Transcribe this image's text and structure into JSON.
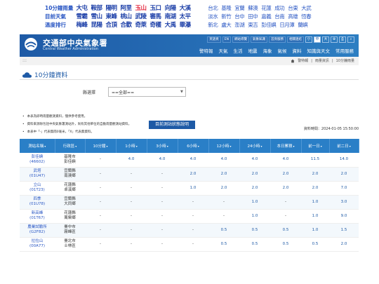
{
  "toplinks": [
    {
      "label": "10分鐘雨量",
      "group1": [
        {
          "t": "大屯",
          "red": false
        },
        {
          "t": "鞍部",
          "red": false
        },
        {
          "t": "陽明",
          "red": false
        },
        {
          "t": "阿里",
          "red": false
        },
        {
          "t": "玉山",
          "red": true
        },
        {
          "t": "玉口",
          "red": false
        },
        {
          "t": "向陽",
          "red": false
        },
        {
          "t": "大溪",
          "red": false
        }
      ],
      "group2": [
        "台北",
        "基隆",
        "宜蘭",
        "蘇澳",
        "花蓮",
        "成功",
        "台東",
        "大武"
      ]
    },
    {
      "label": "目前天氣",
      "group1": [
        {
          "t": "雪霸",
          "red": false
        },
        {
          "t": "雪山",
          "red": false
        },
        {
          "t": "東峰",
          "red": false
        },
        {
          "t": "桃山",
          "red": false
        },
        {
          "t": "武陵",
          "red": false
        },
        {
          "t": "審馬",
          "red": false
        },
        {
          "t": "南湖",
          "red": false
        },
        {
          "t": "太平",
          "red": false
        }
      ],
      "group2": [
        "淡水",
        "新竹",
        "台中",
        "田中",
        "嘉義",
        "台南",
        "高雄",
        "恆春"
      ]
    },
    {
      "label": "溫度排行",
      "group1": [
        {
          "t": "梅峰",
          "red": false
        },
        {
          "t": "昆陽",
          "red": false
        },
        {
          "t": "合頂",
          "red": false
        },
        {
          "t": "合歡",
          "red": false
        },
        {
          "t": "奇萊",
          "red": false
        },
        {
          "t": "奇穫",
          "red": false
        },
        {
          "t": "大禹",
          "red": false
        },
        {
          "t": "畢瀑",
          "red": false
        }
      ],
      "group2": [
        "新北",
        "盧大",
        "澎湖",
        "東吉",
        "彭佳嶼",
        "日月潭",
        "蘭嶼"
      ]
    }
  ],
  "header": {
    "title": "交通部中央氣象署",
    "subtitle": "Central Weather Administration",
    "util": [
      "英語頁",
      "EN",
      "網站導覽",
      "氣象知識",
      "首頁服務",
      "相關連結"
    ],
    "util_squares": [
      "小",
      "中",
      "大",
      "⊕",
      "⎙",
      "⌕"
    ],
    "nav": [
      "警特報",
      "天氣",
      "生活",
      "地震",
      "海象",
      "氣候",
      "資料",
      "知識與天文",
      "常用服務"
    ]
  },
  "breadcrumb": {
    "dots": ":::",
    "items": [
      "警特報",
      "雨量資訊",
      "10分鐘雨量"
    ]
  },
  "page_title": "10分鐘資料",
  "filter": {
    "label": "縣選擇",
    "value": "==全部=="
  },
  "notes": [
    "本表為即時雨量觀測資料，僅供參考使用。",
    "資料來源除包括中央氣象署測站外，尚有其他單位的自動雨量觀測站資料。",
    "本表中「-」代表無雨0毫米，「X」代表無資料。"
  ],
  "status_button": "目前測站狀態說明",
  "data_time": "資料時間：2024-01-05 15:50:00",
  "table": {
    "headers": [
      "測站名稱",
      "行政區",
      "10分鐘",
      "1小時",
      "3小時",
      "6小時",
      "12小時",
      "24小時",
      "本日累積",
      "前一日",
      "前二日"
    ],
    "rows": [
      {
        "name": "彭佳嶼",
        "code": "(46602)",
        "area1": "基隆市",
        "area2": "彭佳嶼",
        "v": [
          "-",
          "4.0",
          "4.0",
          "4.0",
          "4.0",
          "4.0",
          "4.0",
          "11.5",
          "14.0"
        ]
      },
      {
        "name": "武塔",
        "code": "(01U47)",
        "area1": "宜蘭縣",
        "area2": "南澳鄉",
        "v": [
          "-",
          "-",
          "-",
          "2.0",
          "2.0",
          "2.0",
          "2.0",
          "2.0",
          "2.0"
        ]
      },
      {
        "name": "立山",
        "code": "(01T23)",
        "area1": "花蓮縣",
        "area2": "卓溪鄉",
        "v": [
          "-",
          "-",
          "-",
          "1.0",
          "2.0",
          "2.0",
          "2.0",
          "2.0",
          "7.0"
        ]
      },
      {
        "name": "四季",
        "code": "(01U78)",
        "area1": "宜蘭縣",
        "area2": "大同鄉",
        "v": [
          "-",
          "-",
          "-",
          "-",
          "-",
          "1.0",
          "-",
          "1.0",
          "3.0"
        ]
      },
      {
        "name": "新高峰",
        "code": "(01T67)",
        "area1": "花蓮縣",
        "area2": "萬榮鄉",
        "v": [
          "-",
          "-",
          "-",
          "-",
          "-",
          "1.0",
          "-",
          "1.0",
          "9.0"
        ]
      },
      {
        "name": "農業試驗所",
        "code": "(G2F82)",
        "area1": "臺中市",
        "area2": "霧峰區",
        "v": [
          "-",
          "-",
          "-",
          "-",
          "0.5",
          "0.5",
          "0.5",
          "1.0",
          "1.5"
        ]
      },
      {
        "name": "拉拉山",
        "code": "(00A77)",
        "area1": "臺北市",
        "area2": "士林區",
        "v": [
          "-",
          "-",
          "-",
          "-",
          "0.5",
          "0.5",
          "0.5",
          "0.5",
          "2.0"
        ]
      }
    ]
  }
}
